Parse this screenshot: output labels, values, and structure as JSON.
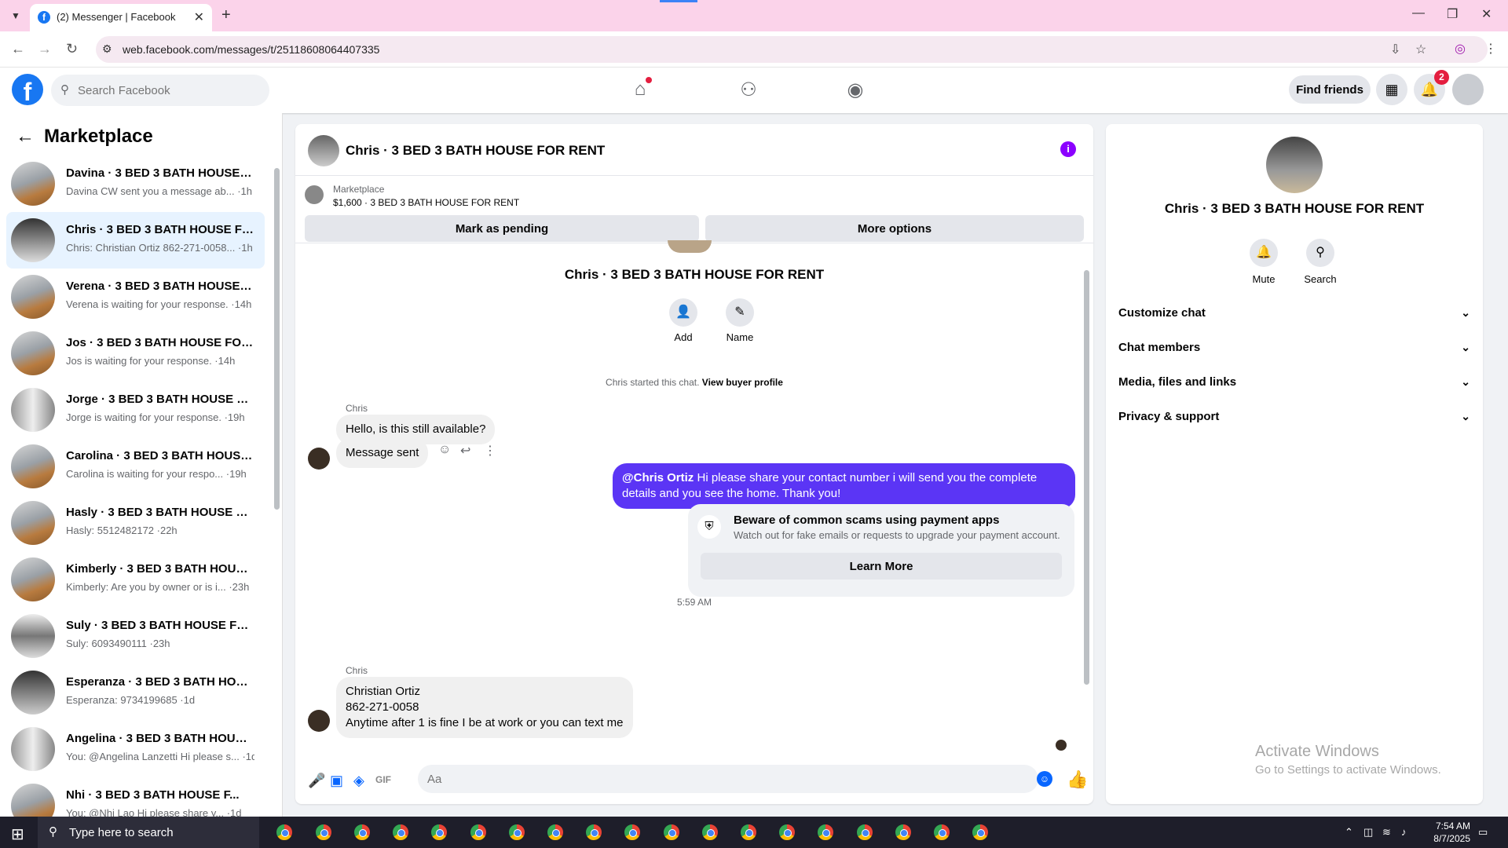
{
  "browser": {
    "tab_title": "(2) Messenger | Facebook",
    "url": "web.facebook.com/messages/t/25118608064407335"
  },
  "fbnav": {
    "search_placeholder": "Search Facebook",
    "find_friends": "Find friends",
    "notification_count": "2"
  },
  "sidebar": {
    "title": "Marketplace",
    "conversations": [
      {
        "name": "Davina · 3 BED 3 BATH HOUSE F...",
        "preview": "Davina CW sent you a message ab... ·1h"
      },
      {
        "name": "Chris · 3 BED 3 BATH HOUSE FO...",
        "preview": "Chris: Christian Ortiz 862-271-0058... ·1h"
      },
      {
        "name": "Verena · 3 BED 3 BATH HOUSE F...",
        "preview": "Verena is waiting for your response. ·14h"
      },
      {
        "name": "Jos · 3 BED 3 BATH HOUSE FOR ...",
        "preview": "Jos is waiting for your response. ·14h"
      },
      {
        "name": "Jorge · 3 BED 3 BATH HOUSE FO...",
        "preview": "Jorge is waiting for your response. ·19h"
      },
      {
        "name": "Carolina · 3 BED 3 BATH HOUSE ...",
        "preview": "Carolina is waiting for your respo... ·19h"
      },
      {
        "name": "Hasly · 3 BED 3 BATH HOUSE FO...",
        "preview": "Hasly: 5512482172 ·22h"
      },
      {
        "name": "Kimberly · 3 BED 3 BATH HOUSE...",
        "preview": "Kimberly: Are you by owner or is i... ·23h"
      },
      {
        "name": "Suly · 3 BED 3 BATH HOUSE FOR...",
        "preview": "Suly: 6093490111 ·23h"
      },
      {
        "name": "Esperanza · 3 BED 3 BATH HOUS...",
        "preview": "Esperanza: 9734199685 ·1d"
      },
      {
        "name": "Angelina · 3 BED 3 BATH HOUSE...",
        "preview": "You: @Angelina Lanzetti Hi please s... ·1d"
      },
      {
        "name": "Nhi · 3 BED 3 BATH HOUSE F...",
        "preview": "You: @Nhi Lao Hi please share y... ·1d"
      }
    ]
  },
  "chat": {
    "header_title": "Chris · 3 BED 3 BATH HOUSE FOR RENT",
    "listing_label": "Marketplace",
    "listing_price": "$1,600 · 3 BED 3 BATH HOUSE FOR RENT",
    "mark_pending": "Mark as pending",
    "more_options": "More options",
    "thread_title": "Chris · 3 BED 3 BATH HOUSE FOR RENT",
    "add_label": "Add",
    "name_label": "Name",
    "started_text": "Chris started this chat.",
    "view_buyer": "View buyer profile",
    "sender1": "Chris",
    "msg1": "Hello, is this still available?",
    "msg2": "Message sent",
    "out_mention": "@Chris Ortiz",
    "out_text": " Hi please share your contact number i will send you the complete details and you see the home. Thank you!",
    "scam_title": "Beware of common scams using payment apps",
    "scam_desc": "Watch out for fake emails or requests to upgrade your payment account.",
    "learn_more": "Learn More",
    "timestamp": "5:59 AM",
    "sender2": "Chris",
    "msg3_line1": "Christian Ortiz",
    "msg3_line2": "862-271-0058",
    "msg3_line3": "Anytime after 1 is fine I be at work or you can text me",
    "composer_placeholder": "Aa"
  },
  "info_panel": {
    "name": "Chris · 3 BED 3 BATH HOUSE FOR RENT",
    "mute": "Mute",
    "search": "Search",
    "sections": [
      "Customize chat",
      "Chat members",
      "Media, files and links",
      "Privacy & support"
    ]
  },
  "watermark": {
    "line1": "Activate Windows",
    "line2": "Go to Settings to activate Windows."
  },
  "taskbar": {
    "search_text": "Type here to search",
    "time": "7:54 AM",
    "date": "8/7/2025"
  },
  "colors": {
    "fb_blue": "#1877f2",
    "outgoing_bubble": "#5b35f5",
    "active_conv": "#e7f3ff",
    "browser_tabbar": "#fbd3ea"
  }
}
